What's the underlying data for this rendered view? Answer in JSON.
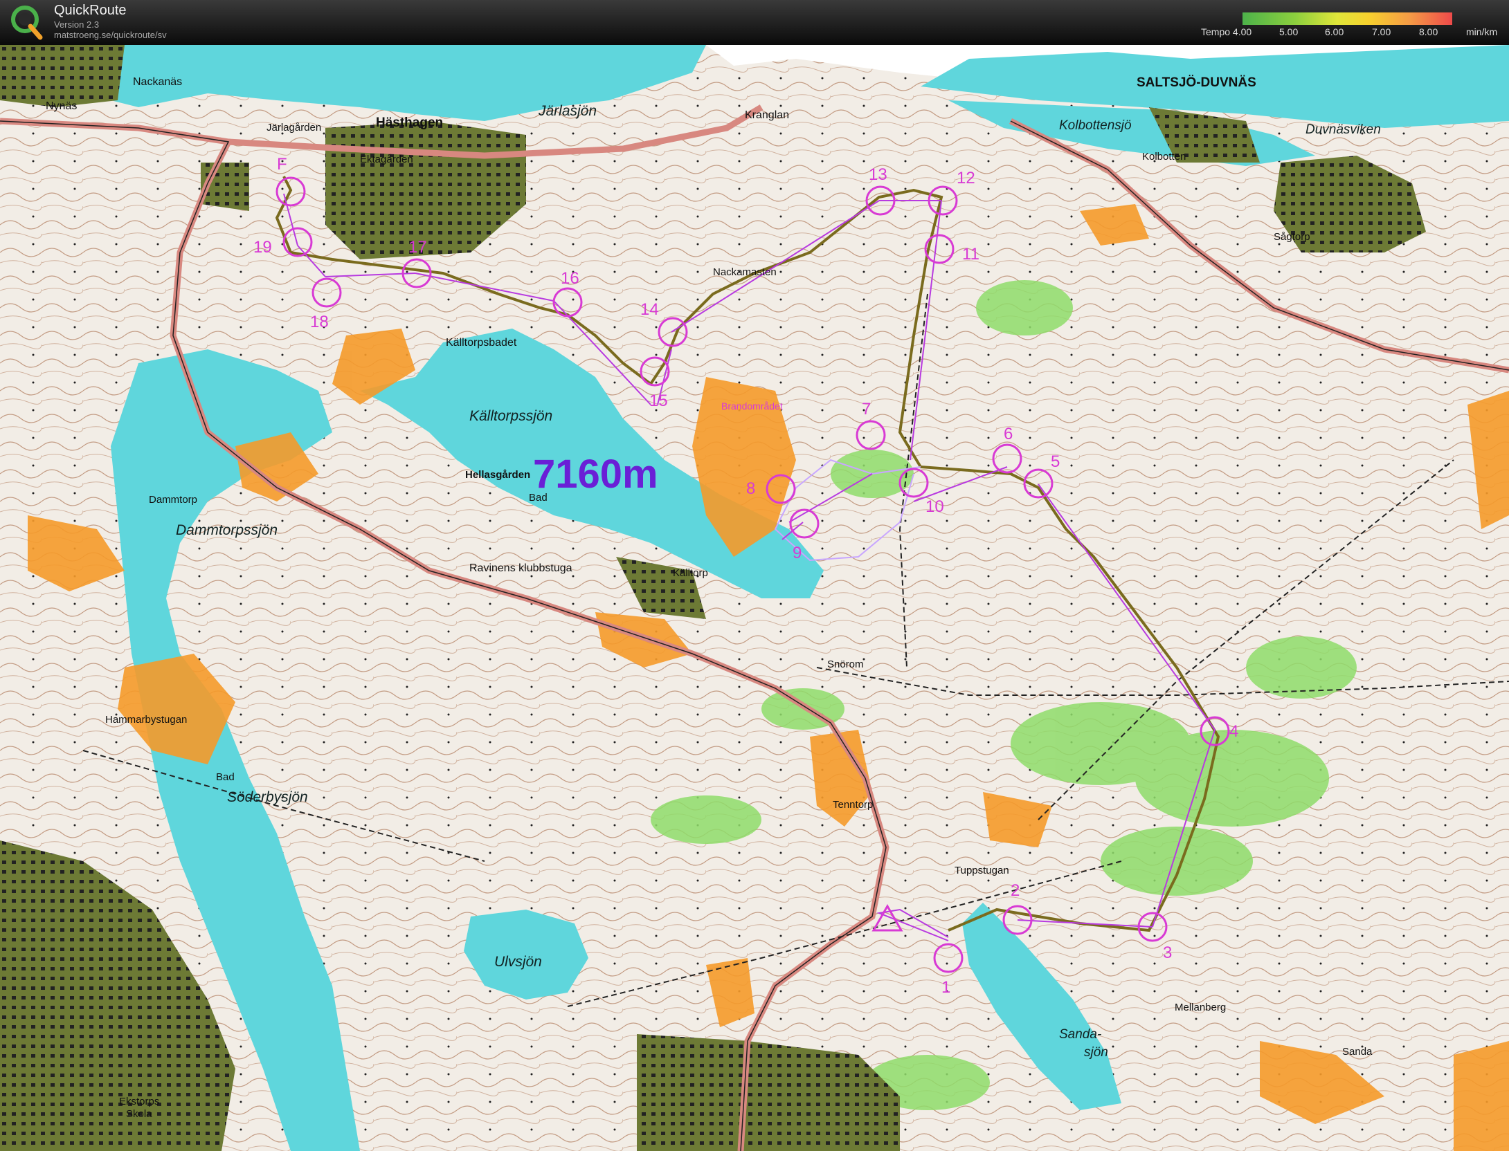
{
  "app": {
    "name": "QuickRoute",
    "version": "Version 2.3",
    "url": "matstroeng.se/quickroute/sv"
  },
  "tempo_legend": {
    "label": "Tempo 4.00",
    "ticks": [
      "5.00",
      "6.00",
      "7.00",
      "8.00"
    ],
    "unit": "min/km"
  },
  "route_length": "7160m",
  "colors": {
    "water": "#5fd6dc",
    "forest_open": "#f2ede6",
    "green": "#8fdc6a",
    "orange": "#f59a2a",
    "urban": "#6d7a35",
    "control": "#d83ad4",
    "route": "#7a6b1e",
    "length_text": "#6a1fd6"
  },
  "place_names": {
    "nackanas": "Nackanäs",
    "nynas": "Nynäs",
    "jarlagarden": "Järlagården",
    "hasthagen": "Hästhagen",
    "jarlasjon": "Järlasjön",
    "kranglan": "Kranglan",
    "saltsjo": "SALTSJÖ-DUVNÄS",
    "kolbottensjo": "Kolbottensjö",
    "kolbotten": "Kolbotten",
    "duvnasviken": "Duvnäsviken",
    "sagtorp": "Sågtorp",
    "ektagarden": "Ektagården",
    "nackamasten": "Nackamasten",
    "kalltorpsbadet": "Källtorpsbadet",
    "kalltorpssjon": "Källtorpssjön",
    "hellasgarden": "Hellasgården",
    "bad": "Bad",
    "dammtorp": "Dammtorp",
    "dammtorpssjon": "Dammtorpssjön",
    "ravinens": "Ravinens klubbstuga",
    "kalltorp": "Källtorp",
    "brandomradet": "Brandområdet",
    "snorom": "Snörom",
    "hammarbystugan": "Hammarbystugan",
    "bad2": "Bad",
    "soderbysjon": "Söderbysjön",
    "tenntorp": "Tenntorp",
    "tuppstugan": "Tuppstugan",
    "ulvsjon": "Ulvsjön",
    "sandasjon_a": "Sanda-",
    "sandasjon_b": "sjön",
    "mellanberg": "Mellanberg",
    "sanda": "Sanda",
    "skola": "Skola",
    "ekstorp": "Ekstorps"
  },
  "controls": [
    "1",
    "2",
    "3",
    "4",
    "5",
    "6",
    "7",
    "8",
    "9",
    "10",
    "11",
    "12",
    "13",
    "14",
    "15",
    "16",
    "17",
    "18",
    "19",
    "F"
  ]
}
